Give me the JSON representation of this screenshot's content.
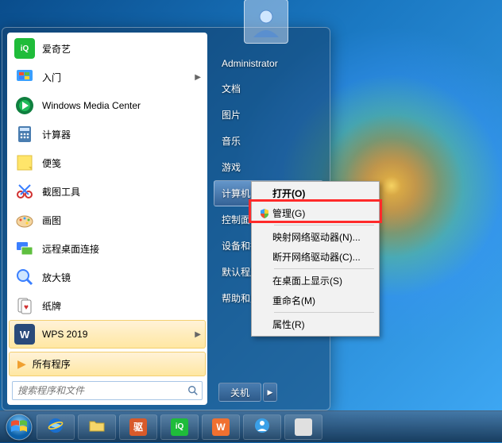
{
  "start_menu": {
    "programs": [
      {
        "label": "爱奇艺",
        "icon": "iqiyi",
        "has_submenu": false
      },
      {
        "label": "入门",
        "icon": "media-center-flag",
        "has_submenu": true
      },
      {
        "label": "Windows Media Center",
        "icon": "media-center",
        "has_submenu": false
      },
      {
        "label": "计算器",
        "icon": "calculator",
        "has_submenu": false
      },
      {
        "label": "便笺",
        "icon": "sticky-notes",
        "has_submenu": false
      },
      {
        "label": "截图工具",
        "icon": "snipping-tool",
        "has_submenu": false
      },
      {
        "label": "画图",
        "icon": "paint",
        "has_submenu": false
      },
      {
        "label": "远程桌面连接",
        "icon": "remote-desktop",
        "has_submenu": false
      },
      {
        "label": "放大镜",
        "icon": "magnifier",
        "has_submenu": false
      },
      {
        "label": "纸牌",
        "icon": "solitaire",
        "has_submenu": false
      },
      {
        "label": "WPS 2019",
        "icon": "wps",
        "has_submenu": true,
        "selected": true
      }
    ],
    "all_programs": "所有程序",
    "right_items": [
      {
        "label": "Administrator"
      },
      {
        "label": "文档"
      },
      {
        "label": "图片"
      },
      {
        "label": "音乐"
      },
      {
        "label": "游戏"
      },
      {
        "label": "计算机",
        "highlight": true
      },
      {
        "label": "控制面板"
      },
      {
        "label": "设备和打印机"
      },
      {
        "label": "默认程序"
      },
      {
        "label": "帮助和支持"
      }
    ],
    "search_placeholder": "搜索程序和文件",
    "shutdown_label": "关机"
  },
  "context_menu": {
    "items": [
      {
        "label": "打开(O)",
        "bold": true
      },
      {
        "label": "管理(G)",
        "icon": "shield"
      },
      {
        "sep": true
      },
      {
        "label": "映射网络驱动器(N)..."
      },
      {
        "label": "断开网络驱动器(C)..."
      },
      {
        "sep": true
      },
      {
        "label": "在桌面上显示(S)"
      },
      {
        "label": "重命名(M)"
      },
      {
        "sep": true
      },
      {
        "label": "属性(R)"
      }
    ]
  },
  "taskbar": {
    "buttons": [
      {
        "name": "internet-explorer",
        "color": "#1a6fcf"
      },
      {
        "name": "file-explorer",
        "color": "#f5d66a"
      },
      {
        "name": "driver-qu",
        "color": "#d85a2a",
        "text": "驱"
      },
      {
        "name": "iqiyi",
        "color": "#1fbc3a"
      },
      {
        "name": "wps",
        "color": "#f07030"
      },
      {
        "name": "support-app",
        "color": "#3aa0e8"
      },
      {
        "name": "disk-app",
        "color": "#e0e0e0"
      }
    ]
  }
}
